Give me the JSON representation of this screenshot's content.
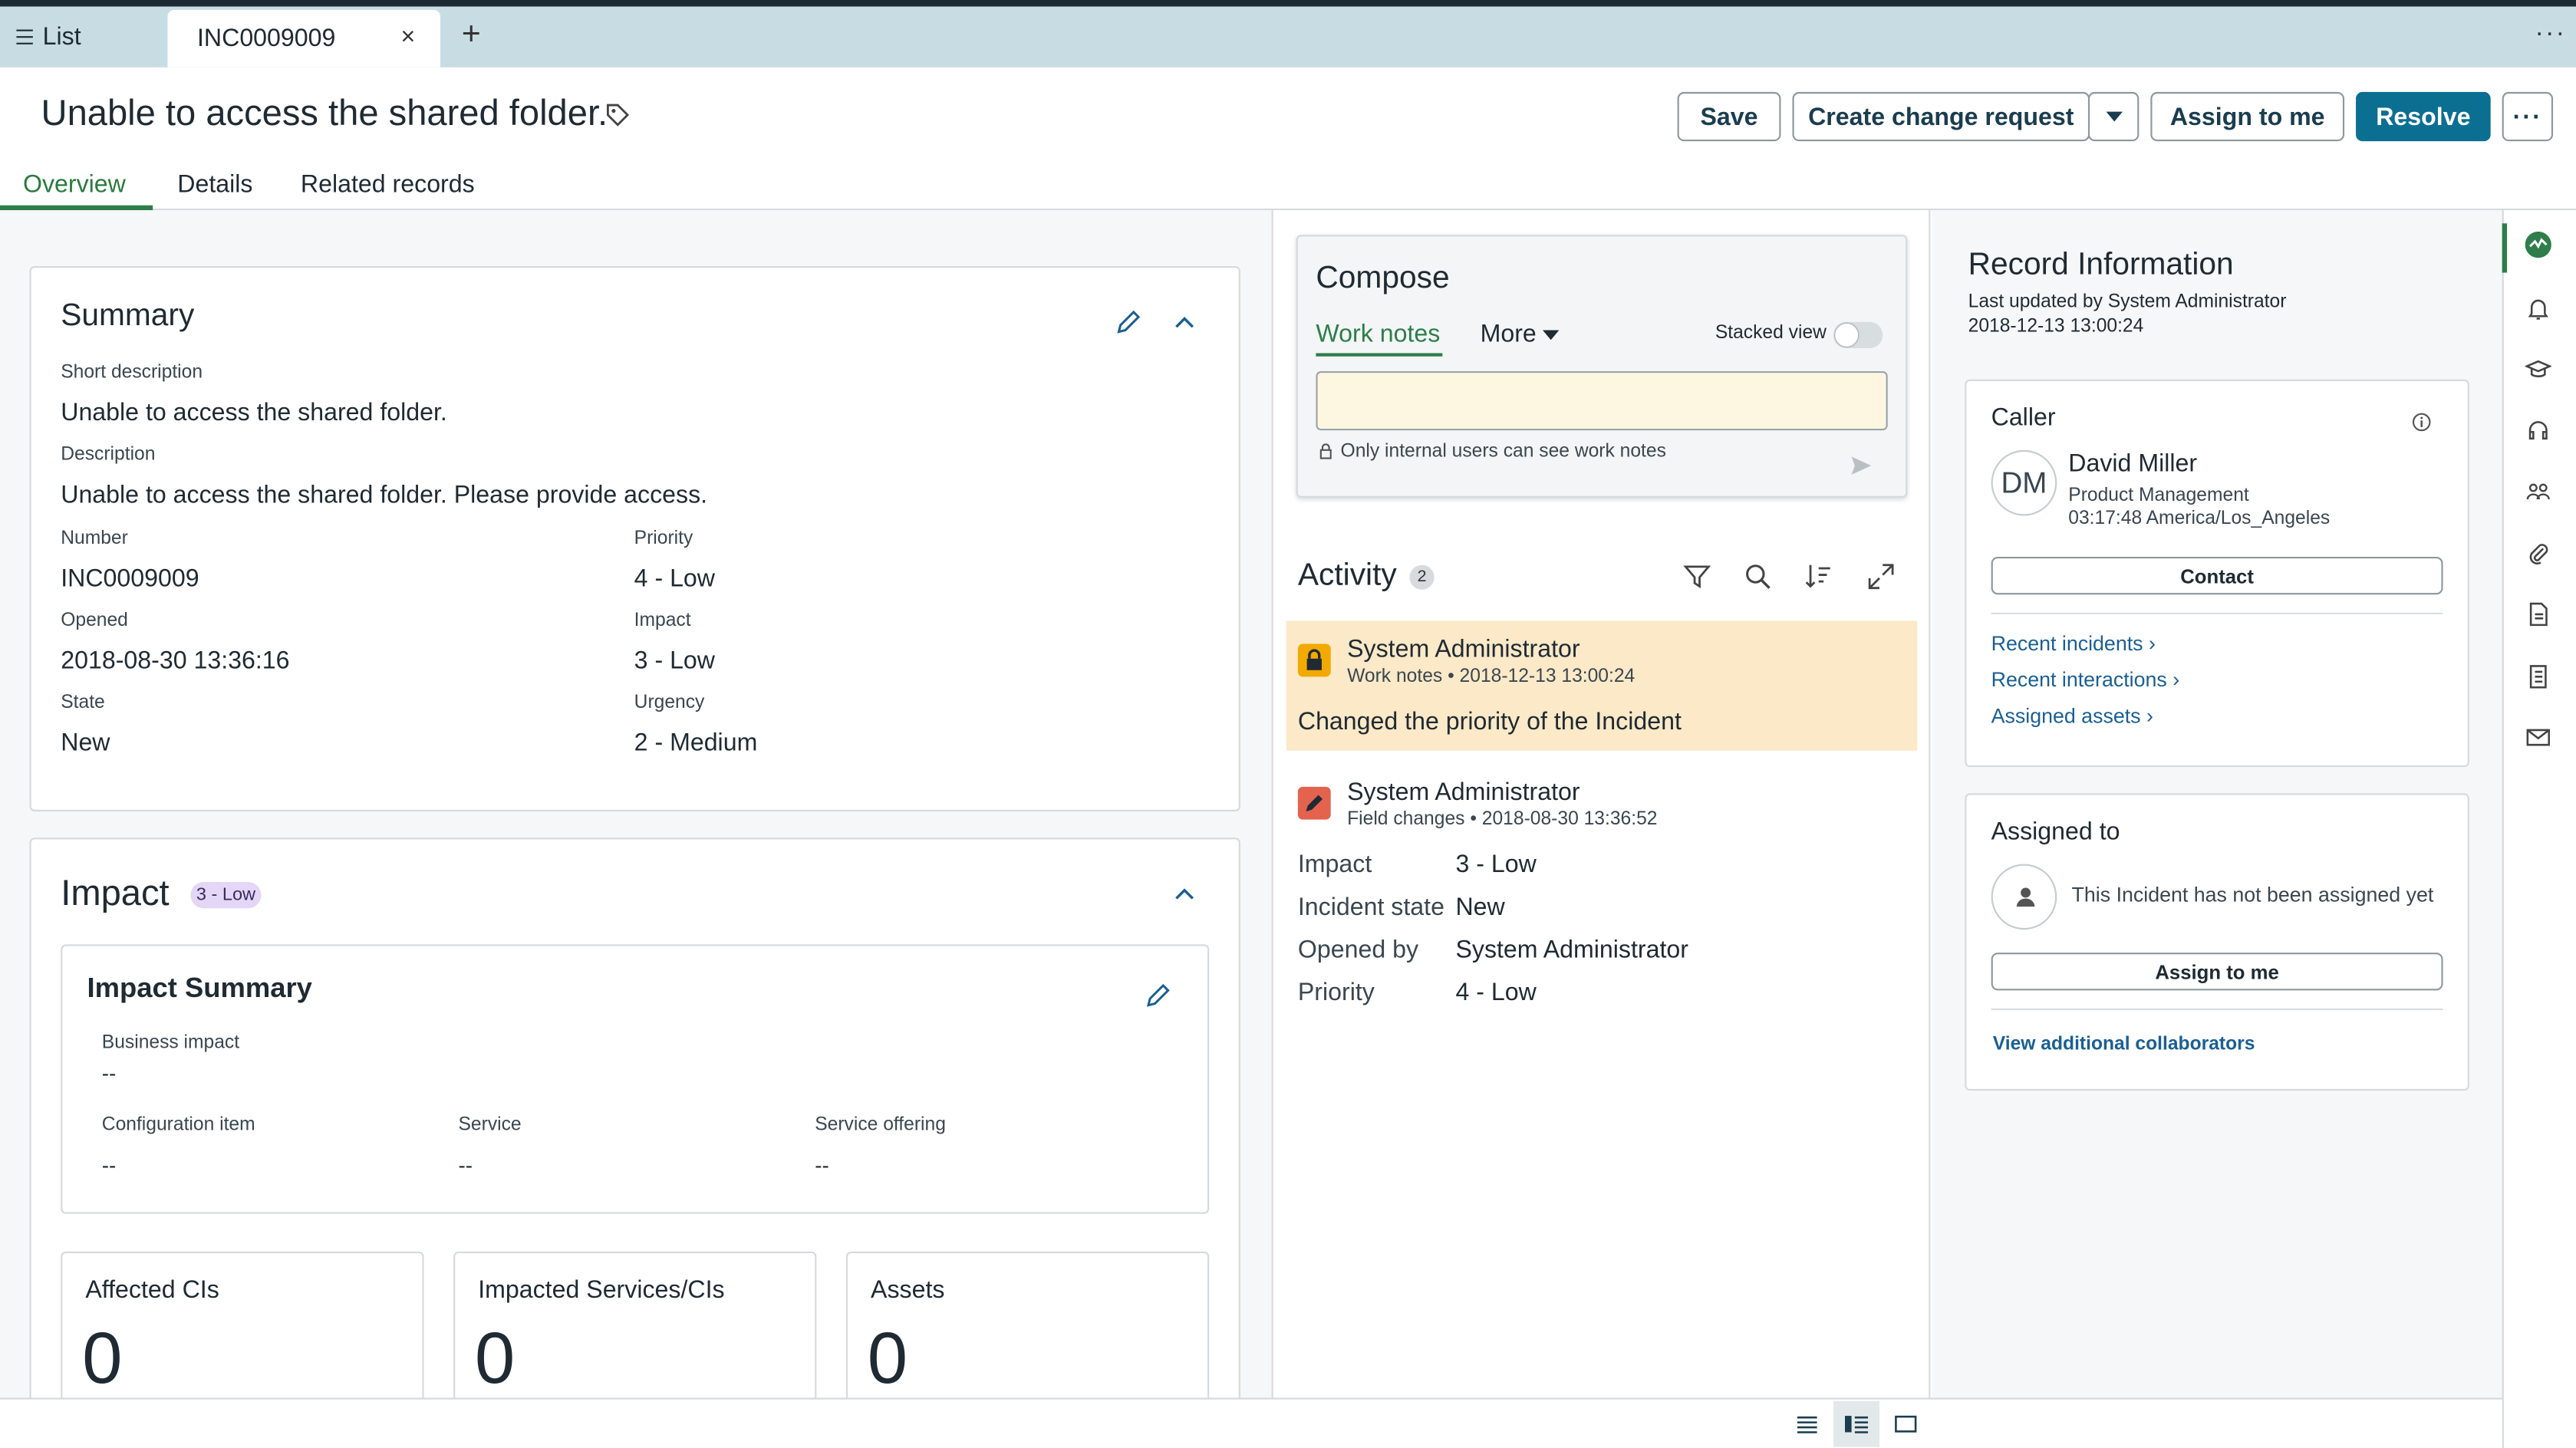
{
  "tabbar": {
    "list_label": "List",
    "active_tab": "INC0009009",
    "close": "×",
    "add": "+",
    "more": "···"
  },
  "header": {
    "title": "Unable to access the shared folder.",
    "buttons": {
      "save": "Save",
      "create_change": "Create change request",
      "assign_to_me": "Assign to me",
      "resolve": "Resolve",
      "more": "···"
    }
  },
  "tabs": [
    "Overview",
    "Details",
    "Related records"
  ],
  "summary": {
    "title": "Summary",
    "short_description_label": "Short description",
    "short_description": "Unable to access the shared folder.",
    "description_label": "Description",
    "description": "Unable to access the shared folder. Please provide access.",
    "number_label": "Number",
    "number": "INC0009009",
    "priority_label": "Priority",
    "priority": "4 - Low",
    "opened_label": "Opened",
    "opened": "2018-08-30 13:36:16",
    "impact_label": "Impact",
    "impact": "3 - Low",
    "state_label": "State",
    "state": "New",
    "urgency_label": "Urgency",
    "urgency": "2 - Medium"
  },
  "impact": {
    "title": "Impact",
    "badge": "3 - Low",
    "summary_title": "Impact Summary",
    "business_impact_label": "Business impact",
    "business_impact": "--",
    "config_item_label": "Configuration item",
    "config_item": "--",
    "service_label": "Service",
    "service": "--",
    "service_offering_label": "Service offering",
    "service_offering": "--",
    "tiles": [
      {
        "label": "Affected CIs",
        "value": "0"
      },
      {
        "label": "Impacted Services/CIs",
        "value": "0"
      },
      {
        "label": "Assets",
        "value": "0"
      }
    ]
  },
  "compose": {
    "title": "Compose",
    "tab_work_notes": "Work notes",
    "tab_more": "More",
    "stacked_view": "Stacked view",
    "notice": "Only internal users can see work notes"
  },
  "activity": {
    "title": "Activity",
    "count": "2",
    "entries": [
      {
        "author": "System Administrator",
        "type": "Work notes",
        "time": "2018-12-13 13:00:24",
        "text": "Changed the priority of the Incident"
      },
      {
        "author": "System Administrator",
        "type": "Field changes",
        "time": "2018-08-30 13:36:52",
        "fields": [
          {
            "name": "Impact",
            "value": "3 - Low"
          },
          {
            "name": "Incident state",
            "value": "New"
          },
          {
            "name": "Opened by",
            "value": "System Administrator"
          },
          {
            "name": "Priority",
            "value": "4 - Low"
          }
        ]
      }
    ]
  },
  "record_info": {
    "title": "Record Information",
    "updated_by": "Last updated by System Administrator",
    "updated_at": "2018-12-13 13:00:24"
  },
  "caller": {
    "title": "Caller",
    "initials": "DM",
    "name": "David Miller",
    "department": "Product Management",
    "local_time": "03:17:48 America/Los_Angeles",
    "contact_button": "Contact",
    "links": [
      "Recent incidents",
      "Recent interactions",
      "Assigned assets"
    ]
  },
  "assigned": {
    "title": "Assigned to",
    "message": "This Incident has not been assigned yet",
    "assign_button": "Assign to me",
    "collaborators_link": "View additional collaborators"
  },
  "colors": {
    "accent_green": "#2e7d4a",
    "primary_blue": "#0b6f92",
    "tab_bar": "#c8dde3",
    "work_note_bg": "#fbe9c7"
  }
}
